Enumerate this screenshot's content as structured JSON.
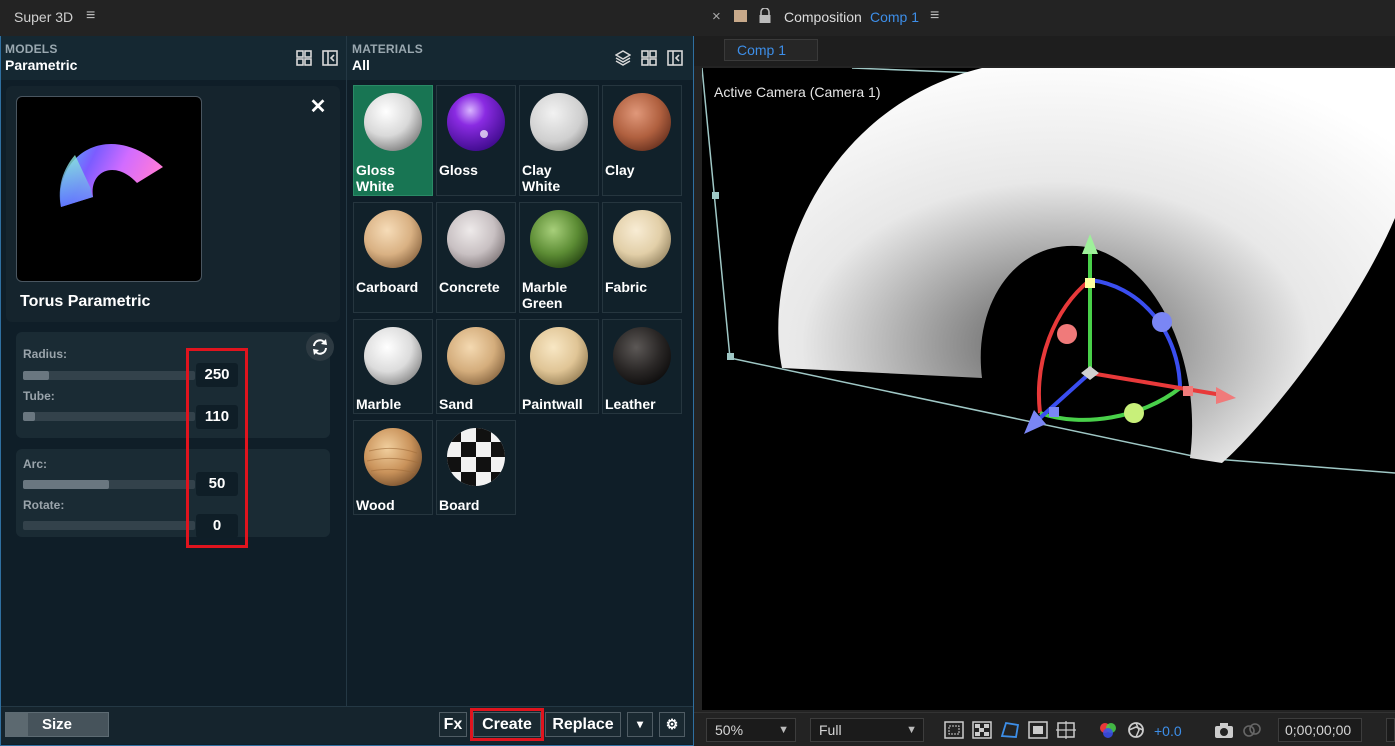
{
  "left_panel": {
    "tab_title": "Super 3D",
    "models": {
      "section_label": "MODELS",
      "current": "Parametric"
    },
    "materials_header": {
      "section_label": "MATERIALS",
      "current": "All"
    },
    "model_card": {
      "name": "Torus Parametric"
    },
    "params": [
      {
        "label": "Radius:",
        "value": "250",
        "fill": 0.15
      },
      {
        "label": "Tube:",
        "value": "110",
        "fill": 0.07
      },
      {
        "label": "Arc:",
        "value": "50",
        "fill": 0.5
      },
      {
        "label": "Rotate:",
        "value": "0",
        "fill": 0.0
      }
    ],
    "materials": [
      {
        "label": "Gloss\nWhite",
        "selected": true
      },
      {
        "label": "Gloss"
      },
      {
        "label": "Clay\nWhite"
      },
      {
        "label": "Clay"
      },
      {
        "label": "Carboard"
      },
      {
        "label": "Concrete"
      },
      {
        "label": "Marble\nGreen"
      },
      {
        "label": "Fabric"
      },
      {
        "label": "Marble"
      },
      {
        "label": "Sand"
      },
      {
        "label": "Paintwall"
      },
      {
        "label": "Leather"
      },
      {
        "label": "Wood"
      },
      {
        "label": "Board"
      }
    ],
    "bottom": {
      "size_label": "Size",
      "fx_label": "Fx",
      "create_label": "Create",
      "replace_label": "Replace",
      "dropdown_glyph": "▾",
      "settings_glyph": "⚙"
    }
  },
  "right_panel": {
    "close_glyph": "×",
    "title_prefix": "Composition",
    "comp_name": "Comp 1",
    "tab_label": "Comp 1",
    "camera_label": "Active Camera (Camera 1)",
    "zoom": "50%",
    "resolution": "Full",
    "exposure": "+0.0",
    "timecode": "0;00;00;00"
  },
  "colors": {
    "accent_blue": "#3d8ee8",
    "selected_material": "#187553",
    "highlight_red": "#e0141e",
    "axis_x": "#e8393a",
    "axis_y": "#49d04a",
    "axis_z": "#3a4ef0"
  }
}
